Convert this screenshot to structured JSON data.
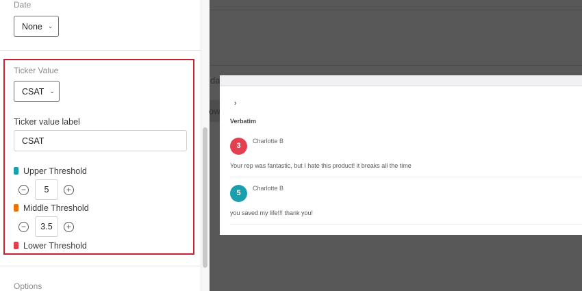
{
  "sidebar": {
    "date": {
      "label": "Date",
      "value": "None"
    },
    "ticker_value": {
      "label": "Ticker Value",
      "value": "CSAT"
    },
    "ticker_value_label": {
      "label": "Ticker value label",
      "value": "CSAT"
    },
    "thresholds": [
      {
        "label": "Upper Threshold",
        "value": "5",
        "color": "#1a9fad"
      },
      {
        "label": "Middle Threshold",
        "value": "3.5",
        "color": "#e8730c"
      },
      {
        "label": "Lower Threshold",
        "color": "#e2404f"
      }
    ],
    "options_label": "Options"
  },
  "background": {
    "frag1": "da",
    "frag2": "ow"
  },
  "panel": {
    "title": "Verbatim",
    "items": [
      {
        "score": "3",
        "name": "Charlotte B",
        "text": "Your rep was fantastic, but I hate this product! it breaks all the time",
        "color": "#e2404f"
      },
      {
        "score": "5",
        "name": "Charlotte B",
        "text": "you saved my life!!! thank you!",
        "color": "#1a9fad"
      }
    ]
  }
}
